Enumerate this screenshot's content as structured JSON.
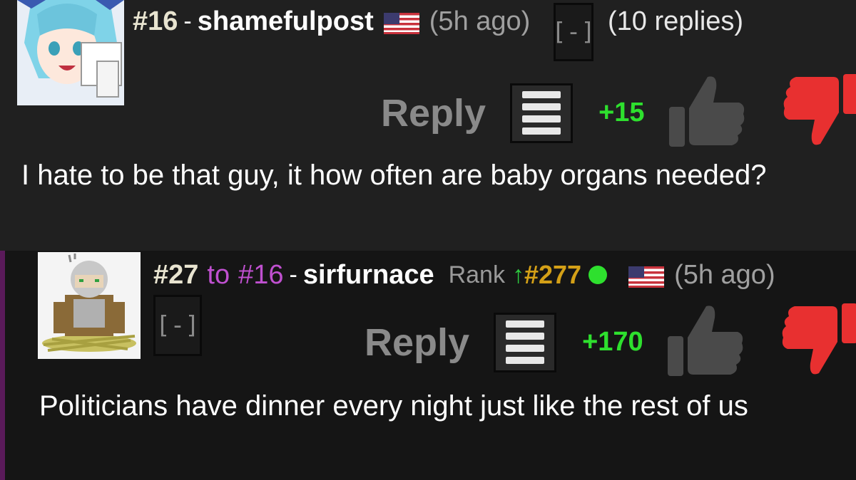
{
  "posts": [
    {
      "number": "#16",
      "separator": "-",
      "username": "shamefulpost",
      "flag_icon": "us-flag-icon",
      "time_ago": "(5h ago)",
      "collapse": "[-]",
      "replies": "(10 replies)",
      "reply_label": "Reply",
      "score": "+15",
      "body": "I hate to be that guy, it how often are baby organs needed?"
    },
    {
      "number": "#27",
      "to": "to",
      "to_number": "#16",
      "separator": "-",
      "username": "sirfurnace",
      "rank_label": "Rank",
      "rank_arrow": "↑",
      "rank_number": "#277",
      "flag_icon": "us-flag-icon",
      "time_ago": "(5h ago)",
      "collapse": "[-]",
      "reply_label": "Reply",
      "score": "+170",
      "body": "Politicians have dinner every night just like the rest of us"
    }
  ],
  "colors": {
    "score_green": "#2ee02e",
    "downvote_red": "#e83030",
    "reply_purple": "#c050d0",
    "rank_gold": "#d4a017"
  }
}
